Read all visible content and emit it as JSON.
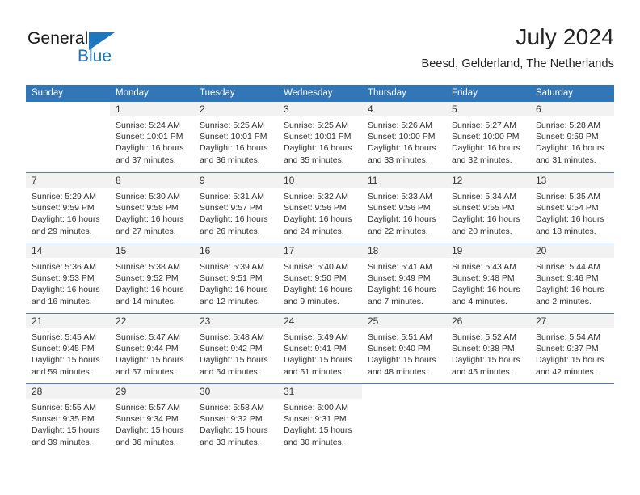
{
  "logo": {
    "word_top": "General",
    "word_bottom": "Blue",
    "triangle_color": "#1e76bd"
  },
  "header": {
    "title": "July 2024",
    "subtitle": "Beesd, Gelderland, The Netherlands"
  },
  "theme": {
    "header_blue": "#3276b8",
    "row_divider": "#4a7ebb",
    "date_band": "#f2f2f2",
    "text": "#303030"
  },
  "weekdays": [
    "Sunday",
    "Monday",
    "Tuesday",
    "Wednesday",
    "Thursday",
    "Friday",
    "Saturday"
  ],
  "weeks": [
    {
      "days": [
        {
          "blank": true
        },
        {
          "date": "1",
          "sunrise": "Sunrise: 5:24 AM",
          "sunset": "Sunset: 10:01 PM",
          "daylight1": "Daylight: 16 hours",
          "daylight2": "and 37 minutes."
        },
        {
          "date": "2",
          "sunrise": "Sunrise: 5:25 AM",
          "sunset": "Sunset: 10:01 PM",
          "daylight1": "Daylight: 16 hours",
          "daylight2": "and 36 minutes."
        },
        {
          "date": "3",
          "sunrise": "Sunrise: 5:25 AM",
          "sunset": "Sunset: 10:01 PM",
          "daylight1": "Daylight: 16 hours",
          "daylight2": "and 35 minutes."
        },
        {
          "date": "4",
          "sunrise": "Sunrise: 5:26 AM",
          "sunset": "Sunset: 10:00 PM",
          "daylight1": "Daylight: 16 hours",
          "daylight2": "and 33 minutes."
        },
        {
          "date": "5",
          "sunrise": "Sunrise: 5:27 AM",
          "sunset": "Sunset: 10:00 PM",
          "daylight1": "Daylight: 16 hours",
          "daylight2": "and 32 minutes."
        },
        {
          "date": "6",
          "sunrise": "Sunrise: 5:28 AM",
          "sunset": "Sunset: 9:59 PM",
          "daylight1": "Daylight: 16 hours",
          "daylight2": "and 31 minutes."
        }
      ]
    },
    {
      "days": [
        {
          "date": "7",
          "sunrise": "Sunrise: 5:29 AM",
          "sunset": "Sunset: 9:59 PM",
          "daylight1": "Daylight: 16 hours",
          "daylight2": "and 29 minutes."
        },
        {
          "date": "8",
          "sunrise": "Sunrise: 5:30 AM",
          "sunset": "Sunset: 9:58 PM",
          "daylight1": "Daylight: 16 hours",
          "daylight2": "and 27 minutes."
        },
        {
          "date": "9",
          "sunrise": "Sunrise: 5:31 AM",
          "sunset": "Sunset: 9:57 PM",
          "daylight1": "Daylight: 16 hours",
          "daylight2": "and 26 minutes."
        },
        {
          "date": "10",
          "sunrise": "Sunrise: 5:32 AM",
          "sunset": "Sunset: 9:56 PM",
          "daylight1": "Daylight: 16 hours",
          "daylight2": "and 24 minutes."
        },
        {
          "date": "11",
          "sunrise": "Sunrise: 5:33 AM",
          "sunset": "Sunset: 9:56 PM",
          "daylight1": "Daylight: 16 hours",
          "daylight2": "and 22 minutes."
        },
        {
          "date": "12",
          "sunrise": "Sunrise: 5:34 AM",
          "sunset": "Sunset: 9:55 PM",
          "daylight1": "Daylight: 16 hours",
          "daylight2": "and 20 minutes."
        },
        {
          "date": "13",
          "sunrise": "Sunrise: 5:35 AM",
          "sunset": "Sunset: 9:54 PM",
          "daylight1": "Daylight: 16 hours",
          "daylight2": "and 18 minutes."
        }
      ]
    },
    {
      "days": [
        {
          "date": "14",
          "sunrise": "Sunrise: 5:36 AM",
          "sunset": "Sunset: 9:53 PM",
          "daylight1": "Daylight: 16 hours",
          "daylight2": "and 16 minutes."
        },
        {
          "date": "15",
          "sunrise": "Sunrise: 5:38 AM",
          "sunset": "Sunset: 9:52 PM",
          "daylight1": "Daylight: 16 hours",
          "daylight2": "and 14 minutes."
        },
        {
          "date": "16",
          "sunrise": "Sunrise: 5:39 AM",
          "sunset": "Sunset: 9:51 PM",
          "daylight1": "Daylight: 16 hours",
          "daylight2": "and 12 minutes."
        },
        {
          "date": "17",
          "sunrise": "Sunrise: 5:40 AM",
          "sunset": "Sunset: 9:50 PM",
          "daylight1": "Daylight: 16 hours",
          "daylight2": "and 9 minutes."
        },
        {
          "date": "18",
          "sunrise": "Sunrise: 5:41 AM",
          "sunset": "Sunset: 9:49 PM",
          "daylight1": "Daylight: 16 hours",
          "daylight2": "and 7 minutes."
        },
        {
          "date": "19",
          "sunrise": "Sunrise: 5:43 AM",
          "sunset": "Sunset: 9:48 PM",
          "daylight1": "Daylight: 16 hours",
          "daylight2": "and 4 minutes."
        },
        {
          "date": "20",
          "sunrise": "Sunrise: 5:44 AM",
          "sunset": "Sunset: 9:46 PM",
          "daylight1": "Daylight: 16 hours",
          "daylight2": "and 2 minutes."
        }
      ]
    },
    {
      "days": [
        {
          "date": "21",
          "sunrise": "Sunrise: 5:45 AM",
          "sunset": "Sunset: 9:45 PM",
          "daylight1": "Daylight: 15 hours",
          "daylight2": "and 59 minutes."
        },
        {
          "date": "22",
          "sunrise": "Sunrise: 5:47 AM",
          "sunset": "Sunset: 9:44 PM",
          "daylight1": "Daylight: 15 hours",
          "daylight2": "and 57 minutes."
        },
        {
          "date": "23",
          "sunrise": "Sunrise: 5:48 AM",
          "sunset": "Sunset: 9:42 PM",
          "daylight1": "Daylight: 15 hours",
          "daylight2": "and 54 minutes."
        },
        {
          "date": "24",
          "sunrise": "Sunrise: 5:49 AM",
          "sunset": "Sunset: 9:41 PM",
          "daylight1": "Daylight: 15 hours",
          "daylight2": "and 51 minutes."
        },
        {
          "date": "25",
          "sunrise": "Sunrise: 5:51 AM",
          "sunset": "Sunset: 9:40 PM",
          "daylight1": "Daylight: 15 hours",
          "daylight2": "and 48 minutes."
        },
        {
          "date": "26",
          "sunrise": "Sunrise: 5:52 AM",
          "sunset": "Sunset: 9:38 PM",
          "daylight1": "Daylight: 15 hours",
          "daylight2": "and 45 minutes."
        },
        {
          "date": "27",
          "sunrise": "Sunrise: 5:54 AM",
          "sunset": "Sunset: 9:37 PM",
          "daylight1": "Daylight: 15 hours",
          "daylight2": "and 42 minutes."
        }
      ]
    },
    {
      "days": [
        {
          "date": "28",
          "sunrise": "Sunrise: 5:55 AM",
          "sunset": "Sunset: 9:35 PM",
          "daylight1": "Daylight: 15 hours",
          "daylight2": "and 39 minutes."
        },
        {
          "date": "29",
          "sunrise": "Sunrise: 5:57 AM",
          "sunset": "Sunset: 9:34 PM",
          "daylight1": "Daylight: 15 hours",
          "daylight2": "and 36 minutes."
        },
        {
          "date": "30",
          "sunrise": "Sunrise: 5:58 AM",
          "sunset": "Sunset: 9:32 PM",
          "daylight1": "Daylight: 15 hours",
          "daylight2": "and 33 minutes."
        },
        {
          "date": "31",
          "sunrise": "Sunrise: 6:00 AM",
          "sunset": "Sunset: 9:31 PM",
          "daylight1": "Daylight: 15 hours",
          "daylight2": "and 30 minutes."
        },
        {
          "blank": true
        },
        {
          "blank": true
        },
        {
          "blank": true
        }
      ]
    }
  ]
}
